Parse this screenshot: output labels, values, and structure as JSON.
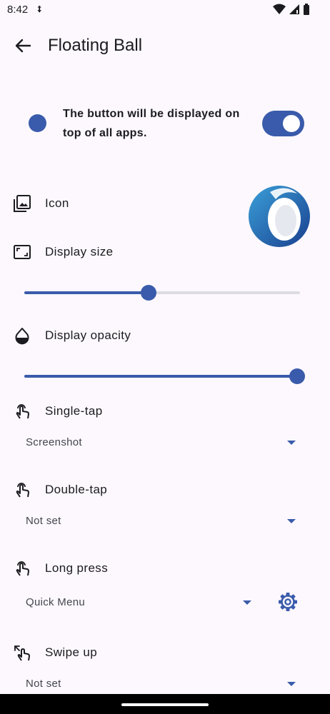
{
  "status_bar": {
    "time": "8:42"
  },
  "app_bar": {
    "title": "Floating Ball"
  },
  "toggle_card": {
    "text": "The button will be displayed on top of all apps.",
    "enabled": true
  },
  "settings": {
    "icon_label": "Icon",
    "display_size_label": "Display size",
    "display_size_value": 0.45,
    "display_opacity_label": "Display opacity",
    "display_opacity_value": 1.0
  },
  "actions": [
    {
      "label": "Single-tap",
      "value": "Screenshot"
    },
    {
      "label": "Double-tap",
      "value": "Not set"
    },
    {
      "label": "Long press",
      "value": "Quick Menu"
    },
    {
      "label": "Swipe up",
      "value": "Not set"
    }
  ],
  "colors": {
    "accent": "#3a5bab",
    "background": "#fcf8fd",
    "track": "#dcdce2"
  }
}
